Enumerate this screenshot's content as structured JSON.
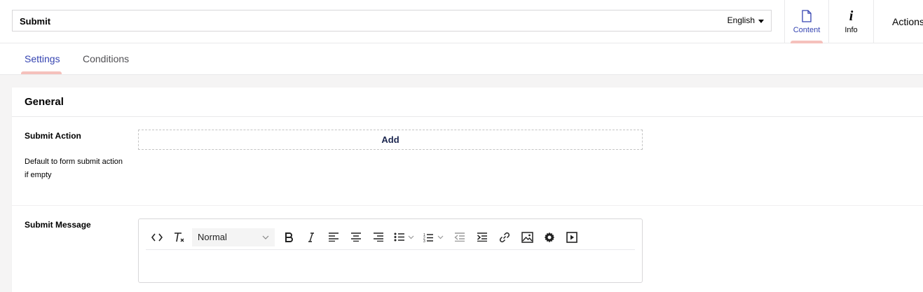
{
  "header": {
    "name_value": "Submit",
    "language": "English",
    "apps": [
      {
        "label": "Content",
        "icon": "document-icon",
        "active": true
      },
      {
        "label": "Info",
        "icon": "info-icon",
        "active": false
      }
    ],
    "actions_label": "Actions"
  },
  "tabs": [
    {
      "label": "Settings",
      "active": true
    },
    {
      "label": "Conditions",
      "active": false
    }
  ],
  "panel": {
    "title": "General",
    "submit_action": {
      "label": "Submit Action",
      "description": "Default to form submit action if empty",
      "add_label": "Add"
    },
    "submit_message": {
      "label": "Submit Message",
      "format_value": "Normal",
      "toolbar_icons": [
        "source-code-icon",
        "clear-format-icon",
        "bold-icon",
        "italic-icon",
        "align-left-icon",
        "align-center-icon",
        "align-right-icon",
        "bullet-list-icon",
        "numbered-list-icon",
        "outdent-icon",
        "indent-icon",
        "link-icon",
        "image-icon",
        "settings-gear-icon",
        "media-play-icon"
      ]
    }
  },
  "colors": {
    "accent": "#3544b1",
    "active_indicator": "#f5c1bc",
    "text_dark": "#1b264f"
  }
}
